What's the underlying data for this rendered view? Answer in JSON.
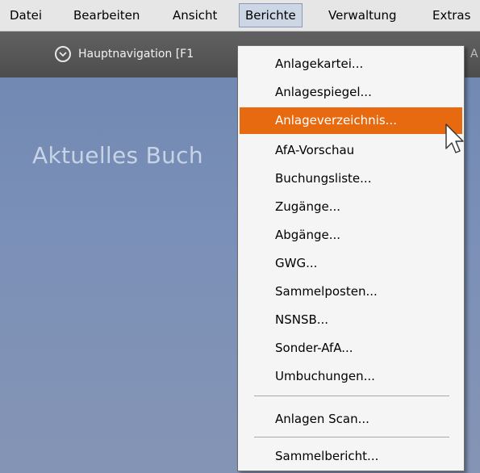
{
  "menubar": {
    "items": [
      "Datei",
      "Bearbeiten",
      "Ansicht",
      "Berichte",
      "Verwaltung",
      "Extras"
    ],
    "active_index": 3
  },
  "toolbar": {
    "nav_label": "Hauptnavigation [F1",
    "cut_text": "A"
  },
  "main": {
    "title": "Aktuelles Buch"
  },
  "menu": {
    "items": [
      "Anlagekartei...",
      "Anlagespiegel...",
      "Anlageverzeichnis...",
      "AfA-Vorschau",
      "Buchungsliste...",
      "Zugänge...",
      "Abgänge...",
      "GWG...",
      "Sammelposten...",
      "NSNSB...",
      "Sonder-AfA...",
      "Umbuchungen...",
      "Anlagen Scan...",
      "Sammelbericht..."
    ],
    "highlighted_index": 2
  },
  "colors": {
    "highlight": "#e86a10",
    "menubar_bg": "#e6e6e6",
    "toolbar_bg": "#555555",
    "main_bg": "#7b90b8"
  },
  "icons": {
    "nav": "chevron-down-circle-icon",
    "cursor": "mouse-pointer-icon"
  }
}
